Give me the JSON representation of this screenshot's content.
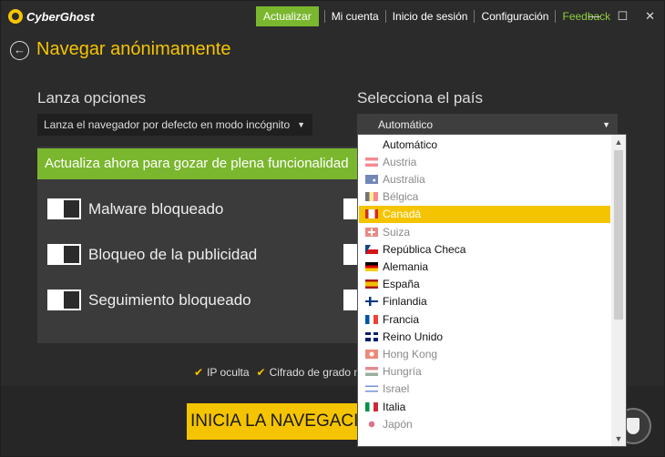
{
  "app": {
    "logo_text": "CyberGhost"
  },
  "nav": {
    "update": "Actualizar",
    "account": "Mi cuenta",
    "login": "Inicio de sesión",
    "settings": "Configuración",
    "feedback": "Feedback"
  },
  "window_controls": {
    "minimize": "—",
    "maximize": "☐",
    "close": "✕"
  },
  "page": {
    "back": "←",
    "title": "Navegar anónimamente"
  },
  "launch": {
    "label": "Lanza opciones",
    "value": "Lanza el navegador por defecto en modo incógnito"
  },
  "country": {
    "label": "Selecciona el país",
    "value": "Automático",
    "options": [
      {
        "label": "Automático",
        "flag": null,
        "enabled": true,
        "selected": false
      },
      {
        "label": "Austria",
        "flag": "austria",
        "enabled": false,
        "selected": false
      },
      {
        "label": "Australia",
        "flag": "australia",
        "enabled": false,
        "selected": false
      },
      {
        "label": "Bélgica",
        "flag": "belgium",
        "enabled": false,
        "selected": false
      },
      {
        "label": "Canadá",
        "flag": "canada",
        "enabled": false,
        "selected": true
      },
      {
        "label": "Suiza",
        "flag": "switzerland",
        "enabled": false,
        "selected": false
      },
      {
        "label": "República Checa",
        "flag": "czech",
        "enabled": true,
        "selected": false
      },
      {
        "label": "Alemania",
        "flag": "germany",
        "enabled": true,
        "selected": false
      },
      {
        "label": "España",
        "flag": "spain",
        "enabled": true,
        "selected": false
      },
      {
        "label": "Finlandia",
        "flag": "finland",
        "enabled": true,
        "selected": false
      },
      {
        "label": "Francia",
        "flag": "france",
        "enabled": true,
        "selected": false
      },
      {
        "label": "Reino Unido",
        "flag": "uk",
        "enabled": true,
        "selected": false
      },
      {
        "label": "Hong Kong",
        "flag": "hongkong",
        "enabled": false,
        "selected": false
      },
      {
        "label": "Hungría",
        "flag": "hungary",
        "enabled": false,
        "selected": false
      },
      {
        "label": "Israel",
        "flag": "israel",
        "enabled": false,
        "selected": false
      },
      {
        "label": "Italia",
        "flag": "italy",
        "enabled": true,
        "selected": false
      },
      {
        "label": "Japón",
        "flag": "japan",
        "enabled": false,
        "selected": false
      }
    ]
  },
  "banner": {
    "text": "Actualiza ahora para gozar de plena funcionalidad"
  },
  "toggles": [
    {
      "label": "Malware bloqueado"
    },
    {
      "label": "Bloqueo de la publicidad"
    },
    {
      "label": "Seguimiento bloqueado"
    }
  ],
  "features": {
    "ip": "IP oculta",
    "encryption": "Cifrado de grado mi"
  },
  "start": {
    "label": "INICIA LA NAVEGACI"
  },
  "colors": {
    "accent": "#f5c400",
    "update_green": "#7ab72e",
    "background": "#2b2b2b"
  }
}
